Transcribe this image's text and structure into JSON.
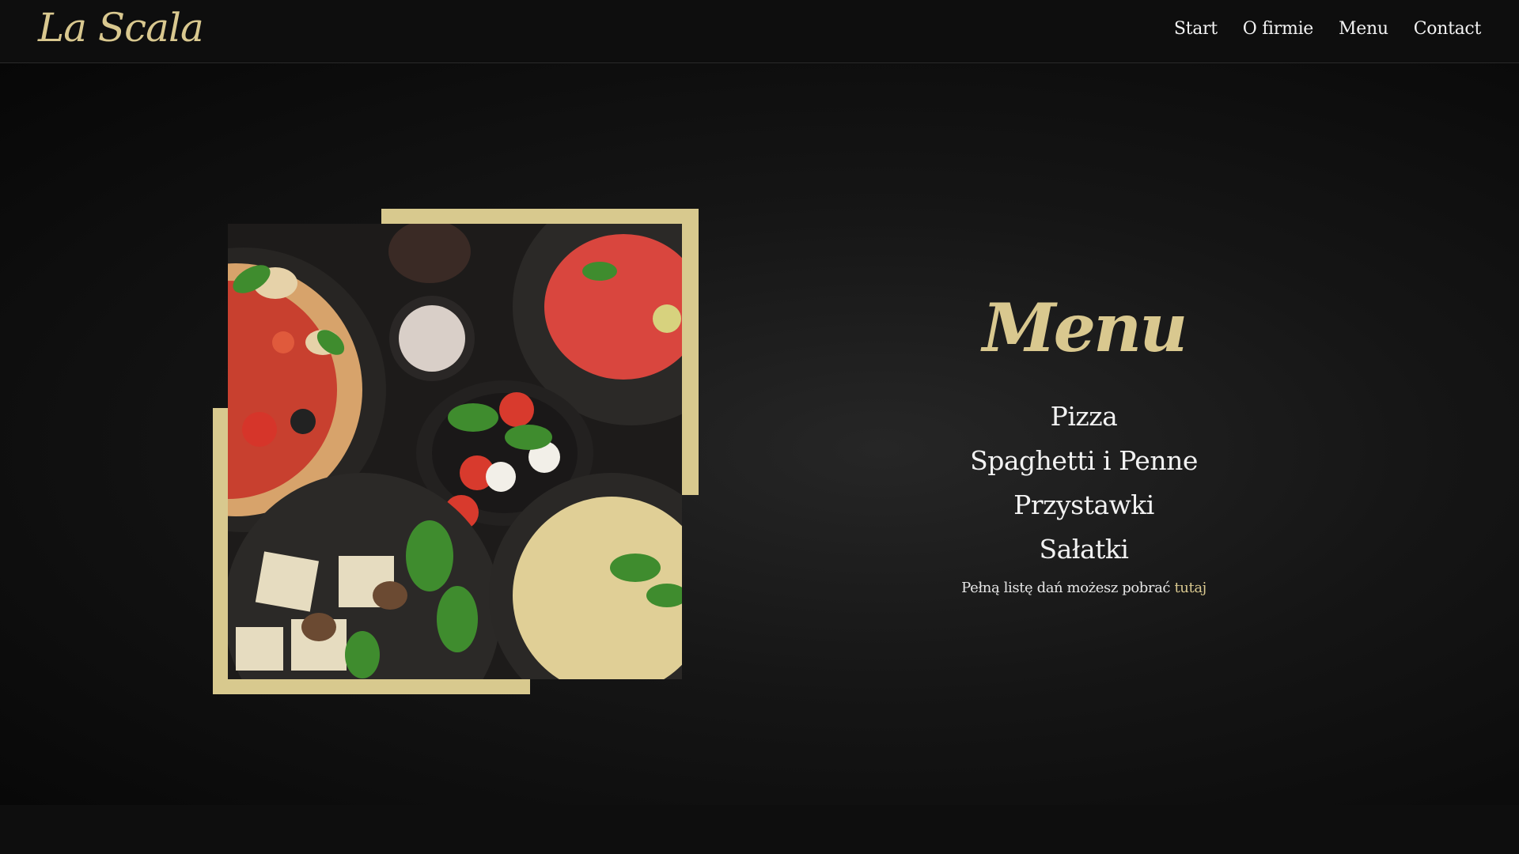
{
  "header": {
    "logo": "La Scala",
    "nav": [
      {
        "label": "Start"
      },
      {
        "label": "O firmie"
      },
      {
        "label": "Menu"
      },
      {
        "label": "Contact"
      }
    ]
  },
  "menu": {
    "title": "Menu",
    "items": [
      {
        "label": "Pizza"
      },
      {
        "label": "Spaghetti i Penne"
      },
      {
        "label": "Przystawki"
      },
      {
        "label": "Sałatki"
      }
    ],
    "download_text": "Pełną listę dań możesz pobrać",
    "download_link": "tutaj"
  },
  "colors": {
    "accent_gold": "#d8c98e",
    "background": "#0b0b0b",
    "text": "#f2f2f2"
  }
}
